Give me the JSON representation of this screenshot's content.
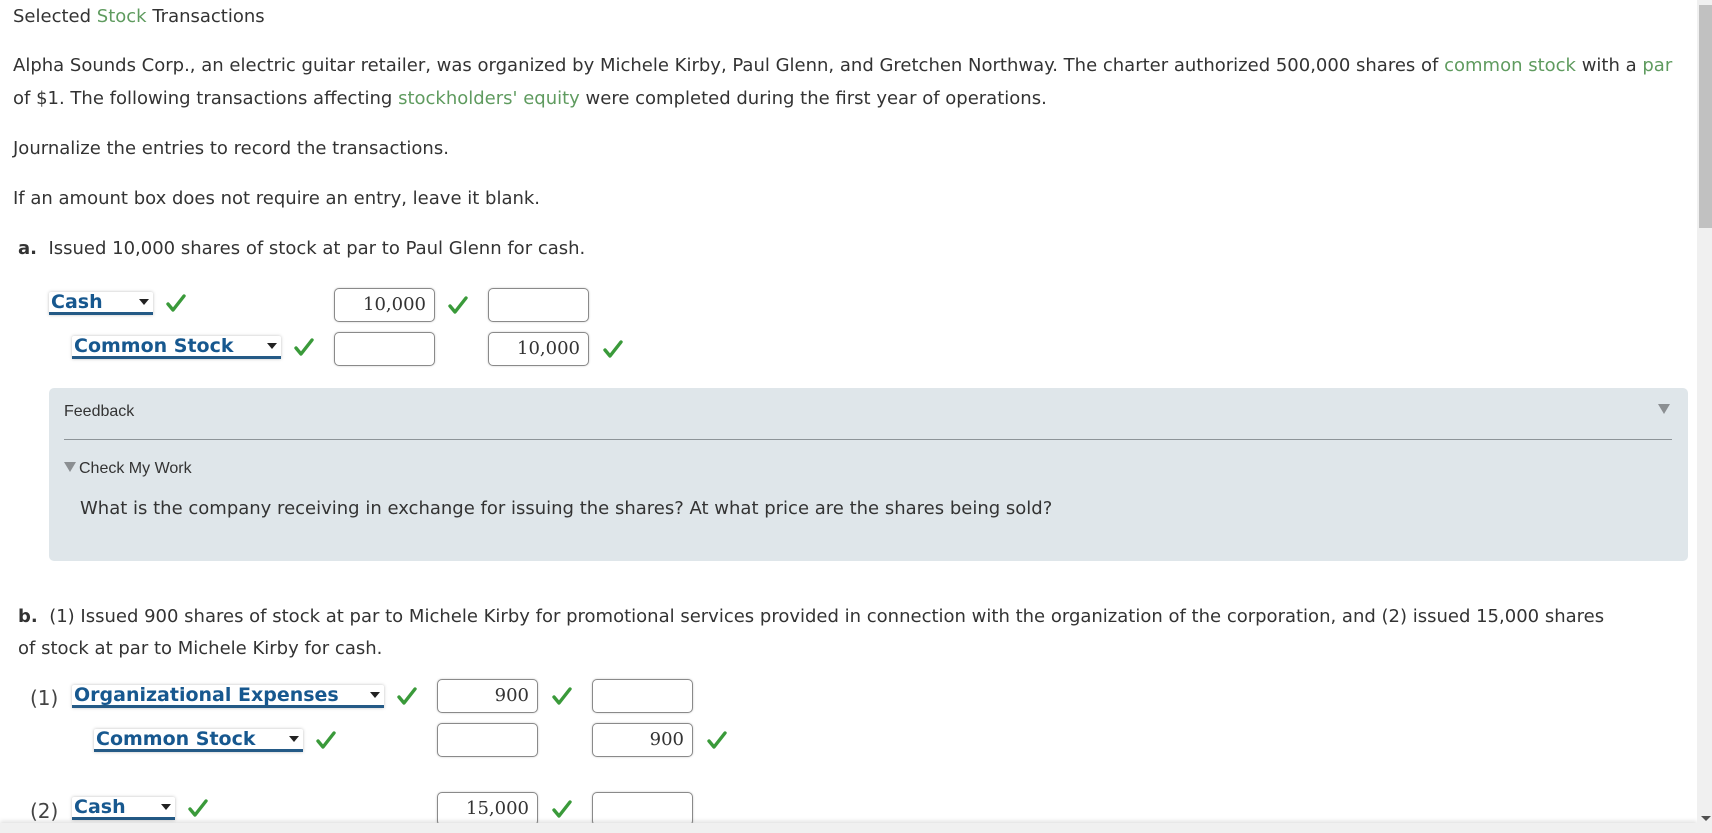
{
  "title": {
    "before": "Selected ",
    "term": "Stock",
    "after": " Transactions"
  },
  "intro": {
    "p1": "Alpha Sounds Corp., an electric guitar retailer, was organized by Michele Kirby, Paul Glenn, and Gretchen Northway. The charter authorized 500,000 shares of ",
    "term1": "common stock",
    "p2": " with a ",
    "term2": "par",
    "p3": " of $1. The following transactions affecting ",
    "term3": "stockholders' equity",
    "p4": " were completed during the first year of operations."
  },
  "instruction1": "Journalize the entries to record the transactions.",
  "instruction2": "If an amount box does not require an entry, leave it blank.",
  "colors": {
    "term_green": "#5f9b5f",
    "account_blue": "#17588f",
    "check_green": "#3a9a3a",
    "feedback_bg": "#dfe6ea"
  },
  "part_a": {
    "label": "a.",
    "text": "Issued 10,000 shares of stock at par to Paul Glenn for cash.",
    "rows": [
      {
        "account": "Cash",
        "debit": "10,000",
        "credit": "",
        "account_correct": true,
        "debit_correct": true
      },
      {
        "account": "Common Stock",
        "debit": "",
        "credit": "10,000",
        "account_correct": true,
        "credit_correct": true
      }
    ],
    "feedback": {
      "title": "Feedback",
      "check_my_work": "Check My Work",
      "message": "What is the company receiving in exchange for issuing the shares? At what price are the shares being sold?"
    }
  },
  "part_b": {
    "label": "b.",
    "text_line1": "(1) Issued 900 shares of stock at par to Michele Kirby for promotional services provided in connection with the organization of the corporation, and (2) issued 15,000 shares",
    "text_line2": "of stock at par to Michele Kirby for cash.",
    "sub1_label": "(1)",
    "sub2_label": "(2)",
    "rows": [
      {
        "account": "Organizational Expenses",
        "debit": "900",
        "credit": ""
      },
      {
        "account": "Common Stock",
        "debit": "",
        "credit": "900"
      },
      {
        "account": "Cash",
        "debit": "15,000",
        "credit": ""
      }
    ]
  },
  "icons": {
    "check": "checkmark-icon",
    "caret": "caret-down-icon"
  }
}
